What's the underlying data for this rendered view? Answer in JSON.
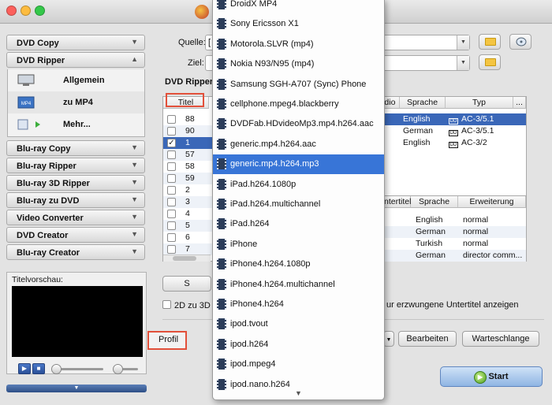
{
  "window": {
    "colors": {
      "close": "#fc605c",
      "minimize": "#fdbc40",
      "zoom": "#34c84a",
      "selection": "#3a67b8",
      "highlight_border": "#e2503a"
    }
  },
  "sidebar": {
    "items": [
      {
        "label": "DVD Copy",
        "expanded": false
      },
      {
        "label": "DVD Ripper",
        "expanded": true
      },
      {
        "label": "Blu-ray Copy"
      },
      {
        "label": "Blu-ray Ripper"
      },
      {
        "label": "Blu-ray 3D Ripper"
      },
      {
        "label": "Blu-ray zu DVD"
      },
      {
        "label": "Video Converter"
      },
      {
        "label": "DVD Creator"
      },
      {
        "label": "Blu-ray Creator"
      }
    ],
    "dvd_ripper_sub": [
      {
        "label": "Allgemein",
        "icon": "monitor-icon"
      },
      {
        "label": "zu MP4",
        "icon": "mp4-icon",
        "selected": true
      },
      {
        "label": "Mehr...",
        "icon": "more-arrow-icon"
      }
    ],
    "preview": {
      "label": "Titelvorschau:",
      "play": "▶",
      "stop": "■"
    }
  },
  "main": {
    "source_label": "Quelle:",
    "source_prefix": "[",
    "target_label": "Ziel:",
    "section_title": "DVD Ripper",
    "titles_table": {
      "headers": {
        "title": "Titel",
        "audio": "udio",
        "language": "Sprache",
        "type": "Typ",
        "more": "..."
      },
      "rows": [
        {
          "title": "88",
          "checked": false
        },
        {
          "title": "90",
          "checked": false
        },
        {
          "title": "1",
          "checked": true,
          "selected": true
        },
        {
          "title": "57",
          "checked": false
        },
        {
          "title": "58",
          "checked": false
        },
        {
          "title": "59",
          "checked": false
        },
        {
          "title": "2",
          "checked": false
        },
        {
          "title": "3",
          "checked": false
        },
        {
          "title": "4",
          "checked": false
        },
        {
          "title": "5",
          "checked": false
        },
        {
          "title": "6",
          "checked": false
        },
        {
          "title": "7",
          "checked": false
        }
      ],
      "audio_rows": [
        {
          "language": "English",
          "type": "AC-3/5.1",
          "selected": true
        },
        {
          "language": "German",
          "type": "AC-3/5.1"
        },
        {
          "language": "English",
          "type": "AC-3/2"
        }
      ]
    },
    "subtitle_table": {
      "headers": {
        "subtitle": "ntertitel",
        "language": "Sprache",
        "extension": "Erweiterung"
      },
      "rows": [
        {
          "language": "English",
          "extension": "normal"
        },
        {
          "language": "German",
          "extension": "normal"
        },
        {
          "language": "Turkish",
          "extension": "normal"
        },
        {
          "language": "German",
          "extension": "director comm..."
        }
      ]
    },
    "button_s": "S",
    "checkbox_2d3d": "2D zu 3D",
    "forced_subs_text": "ur erzwungene Untertitel anzeigen",
    "profil_label": "Profil",
    "edit_button": "Bearbeiten",
    "queue_button": "Warteschlange öffnen",
    "start_button": "Start"
  },
  "dropdown": {
    "items": [
      "DroidX MP4",
      "Sony Ericsson X1",
      "Motorola.SLVR (mp4)",
      "Nokia N93/N95 (mp4)",
      "Samsung SGH-A707 (Sync) Phone",
      "cellphone.mpeg4.blackberry",
      "DVDFab.HDvideoMp3.mp4.h264.aac",
      "generic.mp4.h264.aac",
      "generic.mp4.h264.mp3",
      "iPad.h264.1080p",
      "iPad.h264.multichannel",
      "iPad.h264",
      "iPhone",
      "iPhone4.h264.1080p",
      "iPhone4.h264.multichannel",
      "iPhone4.h264",
      "ipod.tvout",
      "ipod.h264",
      "ipod.mpeg4",
      "ipod.nano.h264"
    ],
    "selected_item": "generic.mp4.h264.mp3",
    "more_indicator": "▼"
  }
}
